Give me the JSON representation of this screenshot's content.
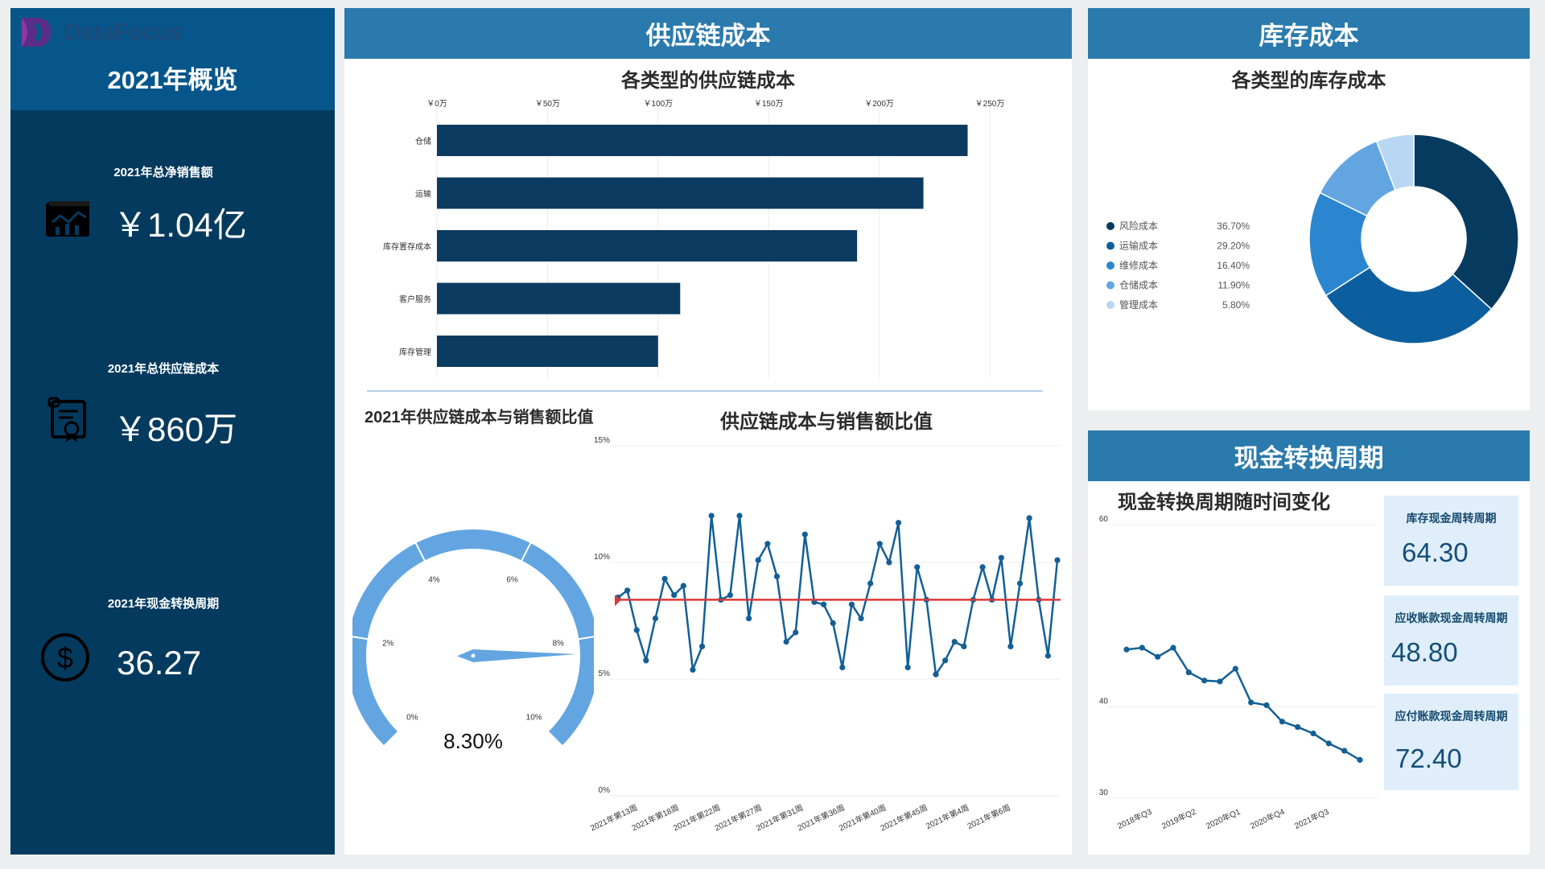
{
  "brand": {
    "name": "DataFocus"
  },
  "left": {
    "title": "2021年概览",
    "kpis": [
      {
        "label": "2021年总净销售额",
        "value": "￥1.04亿",
        "icon": "sales-chart-icon"
      },
      {
        "label": "2021年总供应链成本",
        "value": "￥860万",
        "icon": "certificate-icon"
      },
      {
        "label": "2021年现金转换周期",
        "value": "36.27",
        "icon": "dollar-circle-icon"
      }
    ]
  },
  "supply": {
    "header": "供应链成本",
    "bar_title": "各类型的供应链成本",
    "gauge_title": "2021年供应链成本与销售额比值",
    "gauge_value": "8.30%",
    "line_title": "供应链成本与销售额比值"
  },
  "inventory": {
    "header": "库存成本",
    "donut_title": "各类型的库存成本"
  },
  "cash": {
    "header": "现金转换周期",
    "chart_title": "现金转换周期随时间变化",
    "cards": [
      {
        "label": "库存现金周转周期",
        "value": "64.30"
      },
      {
        "label": "应收账款现金周转周期",
        "value": "48.80"
      },
      {
        "label": "应付账款现金周转周期",
        "value": "72.40"
      }
    ]
  },
  "colors": {
    "header_blue": "#2a7aad",
    "left_dark": "#033a5e",
    "bar": "#0b3b60",
    "line": "#135f96",
    "ref_line": "#d93a3a",
    "gauge": "#62a5e1",
    "card_bg": "#dfeefa"
  },
  "chart_data": [
    {
      "type": "bar",
      "orientation": "horizontal",
      "title": "各类型的供应链成本",
      "categories": [
        "仓储",
        "运输",
        "库存置存成本",
        "客户服务",
        "库存管理"
      ],
      "values": [
        240,
        220,
        190,
        110,
        100
      ],
      "unit": "万",
      "xlim": [
        0,
        250
      ],
      "x_ticks": [
        "￥0万",
        "￥50万",
        "￥100万",
        "￥150万",
        "￥200万",
        "￥250万"
      ],
      "grid": true
    },
    {
      "type": "gauge",
      "title": "2021年供应链成本与销售额比值",
      "value": 8.3,
      "range": [
        0,
        10
      ],
      "ticks": [
        "0%",
        "2%",
        "4%",
        "6%",
        "8%",
        "10%"
      ],
      "value_label": "8.30%"
    },
    {
      "type": "line",
      "title": "供应链成本与销售额比值",
      "ylim": [
        0,
        15
      ],
      "y_ticks": [
        "0%",
        "5%",
        "10%",
        "15%"
      ],
      "x_ticks": [
        "2021年第13周",
        "2021年第18周",
        "2021年第22周",
        "2021年第27周",
        "2021年第31周",
        "2021年第36周",
        "2021年第40周",
        "2021年第45周",
        "2021年第4周",
        "2021年第6周"
      ],
      "values": [
        8.5,
        8.8,
        7.1,
        5.8,
        7.6,
        9.3,
        8.6,
        9.0,
        5.4,
        6.4,
        12.0,
        8.4,
        8.6,
        12.0,
        7.6,
        10.1,
        10.8,
        9.4,
        6.6,
        7.0,
        11.2,
        8.3,
        8.2,
        7.4,
        5.5,
        8.2,
        7.6,
        9.1,
        10.8,
        10.0,
        11.7,
        5.5,
        9.8,
        8.4,
        5.2,
        5.8,
        6.6,
        6.4,
        8.4,
        9.8,
        8.4,
        10.2,
        6.4,
        9.1,
        11.9,
        8.4,
        6.0,
        10.1
      ],
      "reference_line": 8.4,
      "grid": true
    },
    {
      "type": "pie",
      "style": "donut",
      "title": "各类型的库存成本",
      "slices": [
        {
          "label": "风险成本",
          "value": 36.7,
          "display": "36.70%",
          "color": "#063a5f"
        },
        {
          "label": "运输成本",
          "value": 29.2,
          "display": "29.20%",
          "color": "#0c5f9f"
        },
        {
          "label": "维修成本",
          "value": 16.4,
          "display": "16.40%",
          "color": "#2b86cf"
        },
        {
          "label": "仓储成本",
          "value": 11.9,
          "display": "11.90%",
          "color": "#62a5e1"
        },
        {
          "label": "管理成本",
          "value": 5.8,
          "display": "5.80%",
          "color": "#b9d7f2"
        }
      ],
      "legend": "left"
    },
    {
      "type": "line",
      "title": "现金转换周期随时间变化",
      "ylim": [
        30,
        60
      ],
      "y_ticks": [
        "30",
        "40",
        "60"
      ],
      "x_ticks": [
        "2018年Q3",
        "2019年Q2",
        "2020年Q1",
        "2020年Q4",
        "2021年Q3"
      ],
      "values": [
        46.3,
        46.5,
        45.5,
        46.5,
        43.8,
        42.9,
        42.8,
        44.2,
        40.5,
        40.2,
        38.4,
        37.8,
        37.1,
        36.0,
        35.2,
        34.2
      ],
      "grid": true
    }
  ]
}
